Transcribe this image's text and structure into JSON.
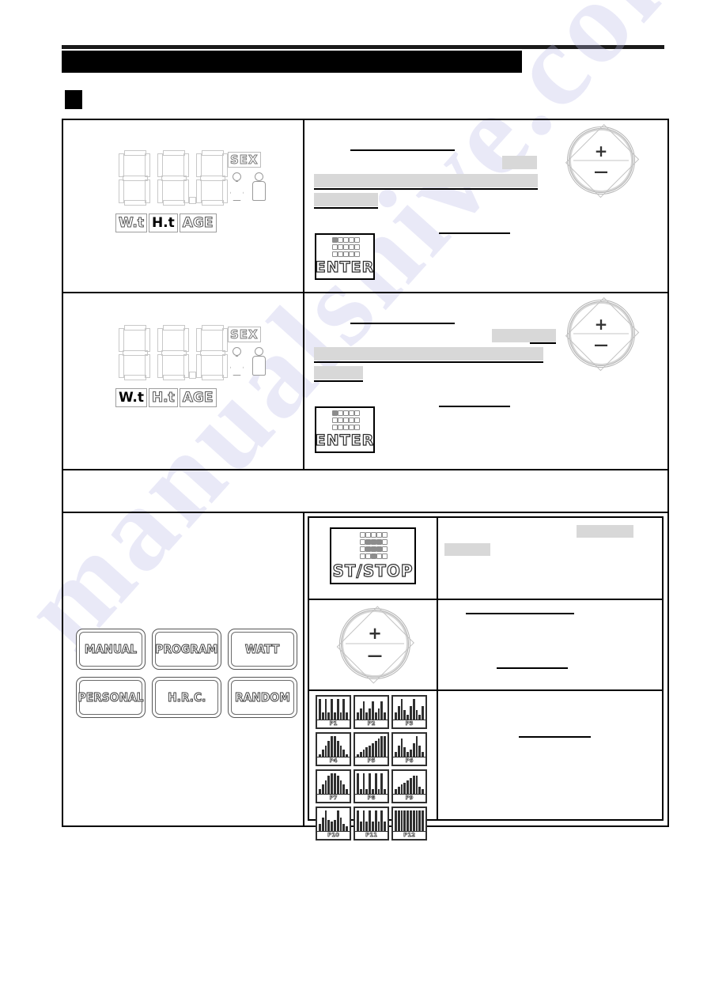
{
  "page": {
    "header_bar_redacted": true,
    "section_marker": "",
    "watermark": "manualshive.com"
  },
  "console": {
    "display_value": "88.8",
    "sex_label": "SEX",
    "figures": [
      "female-figure",
      "male-figure"
    ],
    "unit_labels": [
      "W.t",
      "H.t",
      "AGE"
    ]
  },
  "rows": [
    {
      "id": "row-height",
      "display": {
        "value": "88.8",
        "sex_label": "SEX",
        "active_unit": "H.t",
        "units": [
          "W.t",
          "H.t",
          "AGE"
        ]
      },
      "keys": {
        "enter_label": "ENTER",
        "dial": {
          "plus": "+",
          "minus": "—"
        }
      },
      "redacted_text": [
        "",
        "",
        "",
        "",
        ""
      ]
    },
    {
      "id": "row-weight",
      "display": {
        "value": "88.8",
        "sex_label": "SEX",
        "active_unit": "W.t",
        "units": [
          "W.t",
          "H.t",
          "AGE"
        ]
      },
      "keys": {
        "enter_label": "ENTER",
        "dial": {
          "plus": "+",
          "minus": "—"
        }
      },
      "redacted_text": [
        "",
        "",
        "",
        "",
        ""
      ]
    },
    {
      "id": "row-note",
      "redacted_text": [
        ""
      ]
    },
    {
      "id": "row-program-select",
      "mode_buttons": [
        "MANUAL",
        "PROGRAM",
        "WATT",
        "PERSONAL",
        "H.R.C.",
        "RANDOM"
      ],
      "sub_rows": [
        {
          "id": "sub-start-stop",
          "key_label": "ST/STOP",
          "redacted_text": [
            "",
            ""
          ]
        },
        {
          "id": "sub-dial",
          "dial": {
            "plus": "+",
            "minus": "—"
          },
          "redacted_text": [
            "",
            ""
          ]
        },
        {
          "id": "sub-programs",
          "redacted_text": [
            ""
          ]
        }
      ]
    }
  ],
  "programs": [
    {
      "label": "P1",
      "values": [
        9,
        3,
        9,
        3,
        9,
        3,
        9,
        3,
        9,
        3
      ]
    },
    {
      "label": "P2",
      "values": [
        3,
        5,
        8,
        3,
        5,
        8,
        3,
        5,
        8,
        3
      ]
    },
    {
      "label": "P3",
      "values": [
        3,
        6,
        9,
        4,
        2,
        6,
        9,
        4,
        2,
        6
      ]
    },
    {
      "label": "P4",
      "values": [
        1,
        3,
        5,
        7,
        9,
        9,
        7,
        5,
        3,
        1
      ]
    },
    {
      "label": "P5",
      "values": [
        1,
        2,
        3,
        4,
        5,
        6,
        7,
        8,
        9,
        9
      ]
    },
    {
      "label": "P6",
      "values": [
        2,
        5,
        8,
        4,
        2,
        3,
        6,
        9,
        5,
        2
      ]
    },
    {
      "label": "P7",
      "values": [
        2,
        4,
        6,
        8,
        9,
        9,
        8,
        6,
        4,
        2
      ]
    },
    {
      "label": "P8",
      "values": [
        9,
        2,
        9,
        2,
        9,
        2,
        9,
        2,
        9,
        2
      ]
    },
    {
      "label": "P9",
      "values": [
        2,
        3,
        4,
        5,
        6,
        7,
        8,
        8,
        3,
        2
      ]
    },
    {
      "label": "P10",
      "values": [
        3,
        6,
        9,
        5,
        4,
        5,
        9,
        6,
        3,
        2
      ]
    },
    {
      "label": "P11",
      "values": [
        9,
        4,
        9,
        4,
        9,
        4,
        9,
        4,
        9,
        4
      ]
    },
    {
      "label": "P12",
      "values": [
        9,
        9,
        9,
        9,
        9,
        9,
        9,
        9,
        9,
        9
      ]
    }
  ],
  "colors": {
    "ink": "#000000",
    "redaction_gray": "#d8d8d8",
    "lcd_outline": "#c8c8c8",
    "watermark": "#b9b9e8"
  }
}
